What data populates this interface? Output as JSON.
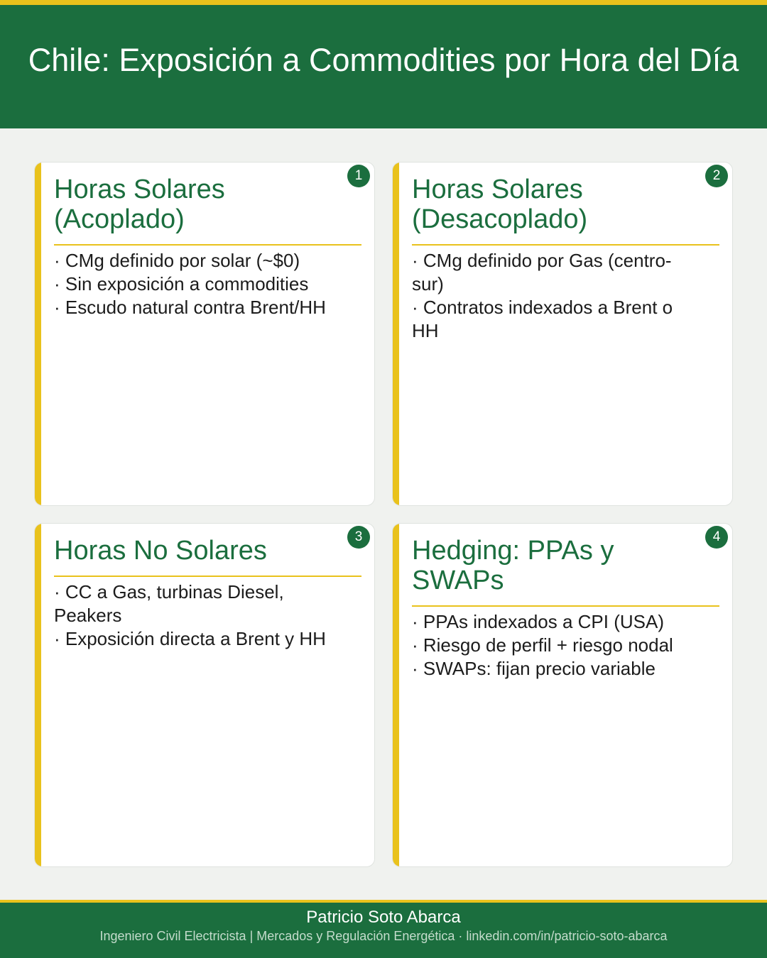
{
  "header": {
    "title": "Chile: Exposición a Commodities por Hora del Día"
  },
  "cards": [
    {
      "number": "1",
      "title_line1": "Horas Solares",
      "title_line2": "(Acoplado)",
      "bullets": [
        "· CMg definido por solar (~$0)",
        "· Sin exposición a commodities",
        "· Escudo natural contra Brent/HH"
      ]
    },
    {
      "number": "2",
      "title_line1": "Horas Solares",
      "title_line2": "(Desacoplado)",
      "bullets": [
        "· CMg definido por Gas (centro-sur)",
        "· Contratos indexados a Brent o HH"
      ]
    },
    {
      "number": "3",
      "title_line1": "Horas No Solares",
      "bullets": [
        "· CC a Gas, turbinas Diesel, Peakers",
        "· Exposición directa a Brent y HH"
      ]
    },
    {
      "number": "4",
      "title_line1": "Hedging: PPAs y",
      "title_line2": "SWAPs",
      "bullets": [
        "· PPAs indexados a CPI (USA)",
        "· Riesgo de perfil + riesgo nodal",
        "· SWAPs: fijan precio variable"
      ]
    }
  ],
  "footer": {
    "name": "Patricio Soto Abarca",
    "subtitle": "Ingeniero Civil Electricista | Mercados y Regulación Energética  ·  linkedin.com/in/patricio-soto-abarca"
  },
  "colors": {
    "brand_green": "#1b6e3e",
    "accent_yellow": "#e9c21c",
    "background": "#f0f2ef"
  }
}
